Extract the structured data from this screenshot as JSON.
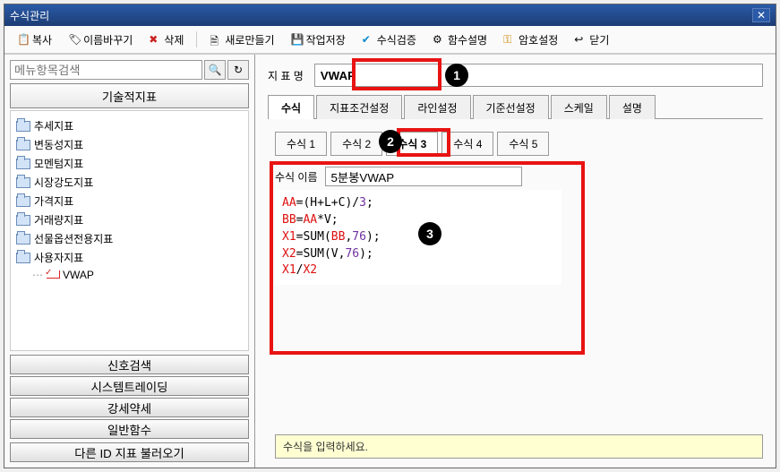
{
  "window": {
    "title": "수식관리"
  },
  "toolbar": {
    "copy": "복사",
    "rename": "이름바꾸기",
    "delete": "삭제",
    "new": "새로만들기",
    "save": "작업저장",
    "verify": "수식검증",
    "funchelp": "함수설명",
    "password": "암호설정",
    "close": "닫기"
  },
  "left": {
    "search_placeholder": "메뉴항목검색",
    "header": "기술적지표",
    "tree": [
      "추세지표",
      "변동성지표",
      "모멘텀지표",
      "시장강도지표",
      "가격지표",
      "거래량지표",
      "선물옵션전용지표",
      "사용자지표"
    ],
    "tree_leaf": "VWAP",
    "buttons": [
      "신호검색",
      "시스템트레이딩",
      "강세약세",
      "일반함수"
    ],
    "load": "다른 ID 지표 불러오기"
  },
  "right": {
    "indicator_label": "지 표 명",
    "indicator_value": "VWAP",
    "tabs": [
      "수식",
      "지표조건설정",
      "라인설정",
      "기준선설정",
      "스케일",
      "설명"
    ],
    "subtabs": [
      "수식 1",
      "수식 2",
      "수식 3",
      "수식 4",
      "수식 5"
    ],
    "active_subtab_index": 2,
    "formula_name_label": "수식 이름",
    "formula_name_value": "5분봉VWAP",
    "code_lines": [
      {
        "v": "AA",
        "rest": "=(H+L+C)/",
        "num": "3",
        "tail": ";"
      },
      {
        "v": "BB",
        "rest": "=",
        "ref": "AA",
        "rest2": "*V;"
      },
      {
        "v": "X1",
        "rest": "=SUM(",
        "ref": "BB",
        "rest2": ",",
        "num": "76",
        "tail": ");"
      },
      {
        "v": "X2",
        "rest": "=SUM(V,",
        "num": "76",
        "tail": ");"
      },
      {
        "v": "X1",
        "rest": "/",
        "ref": "X2"
      }
    ],
    "hint": "수식을 입력하세요."
  },
  "badges": [
    "1",
    "2",
    "3"
  ]
}
